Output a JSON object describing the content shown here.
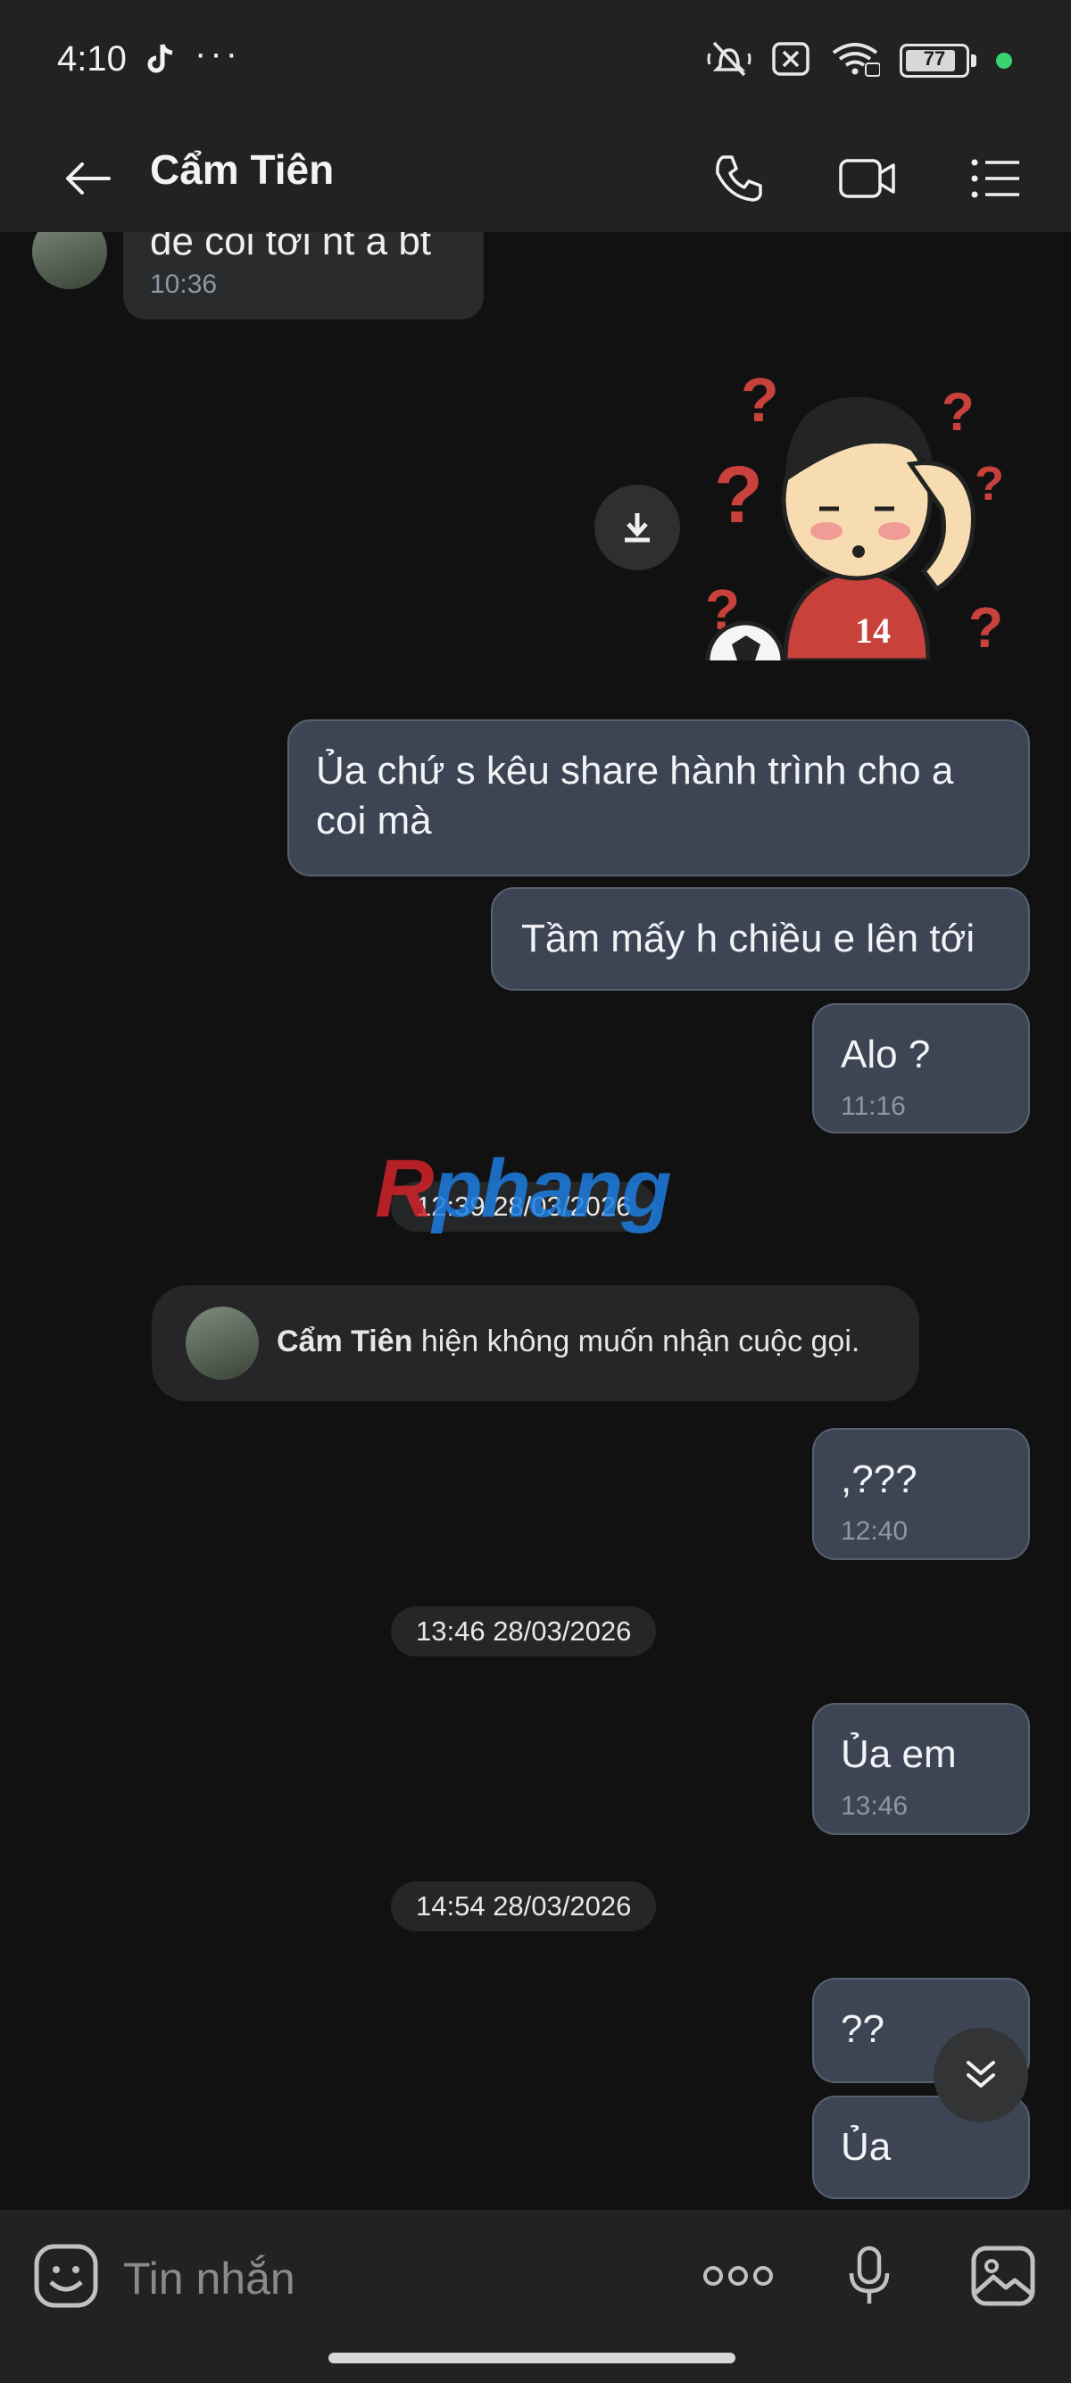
{
  "status_bar": {
    "time": "4:10",
    "dots": "···",
    "battery": "77",
    "icons": [
      "tiktok-icon",
      "mute-vibrate-icon",
      "no-sim-icon",
      "wifi-icon",
      "battery-icon"
    ]
  },
  "header": {
    "title": "Cẩm Tiên",
    "icons": [
      "back-arrow-icon",
      "phone-icon",
      "video-icon",
      "menu-icon"
    ]
  },
  "messages": {
    "partial_in": {
      "text": "đê coi tới nt a bt",
      "time": "10:36"
    },
    "out_1": {
      "text": "Ủa chứ s kêu share hành trình cho a coi mà"
    },
    "out_2": {
      "text": "Tầm mấy h chiều e lên tới"
    },
    "out_3": {
      "text": "Alo ?",
      "time": "11:16"
    },
    "date_1": "12:39 28/03/2026",
    "system": {
      "name": "Cẩm Tiên",
      "text": " hiện không muốn nhận cuộc gọi."
    },
    "out_4": {
      "text": ",???",
      "time": "12:40"
    },
    "date_2": "13:46 28/03/2026",
    "out_5": {
      "text": "Ủa em",
      "time": "13:46"
    },
    "date_3": "14:54 28/03/2026",
    "out_6": {
      "text": "??"
    },
    "out_7": {
      "text": "Ủa"
    }
  },
  "sticker": {
    "jersey_number": "14"
  },
  "watermark": {
    "first": "R",
    "rest": "phang"
  },
  "input": {
    "placeholder": "Tin nhắn",
    "more_label": "ooo",
    "icons": [
      "emoji-icon",
      "more-icon",
      "mic-icon",
      "image-icon"
    ]
  },
  "colors": {
    "background": "#111112",
    "outgoing_bubble": "#3d4554",
    "incoming_bubble": "#2a2b2d",
    "online_dot": "#3ad16f"
  }
}
